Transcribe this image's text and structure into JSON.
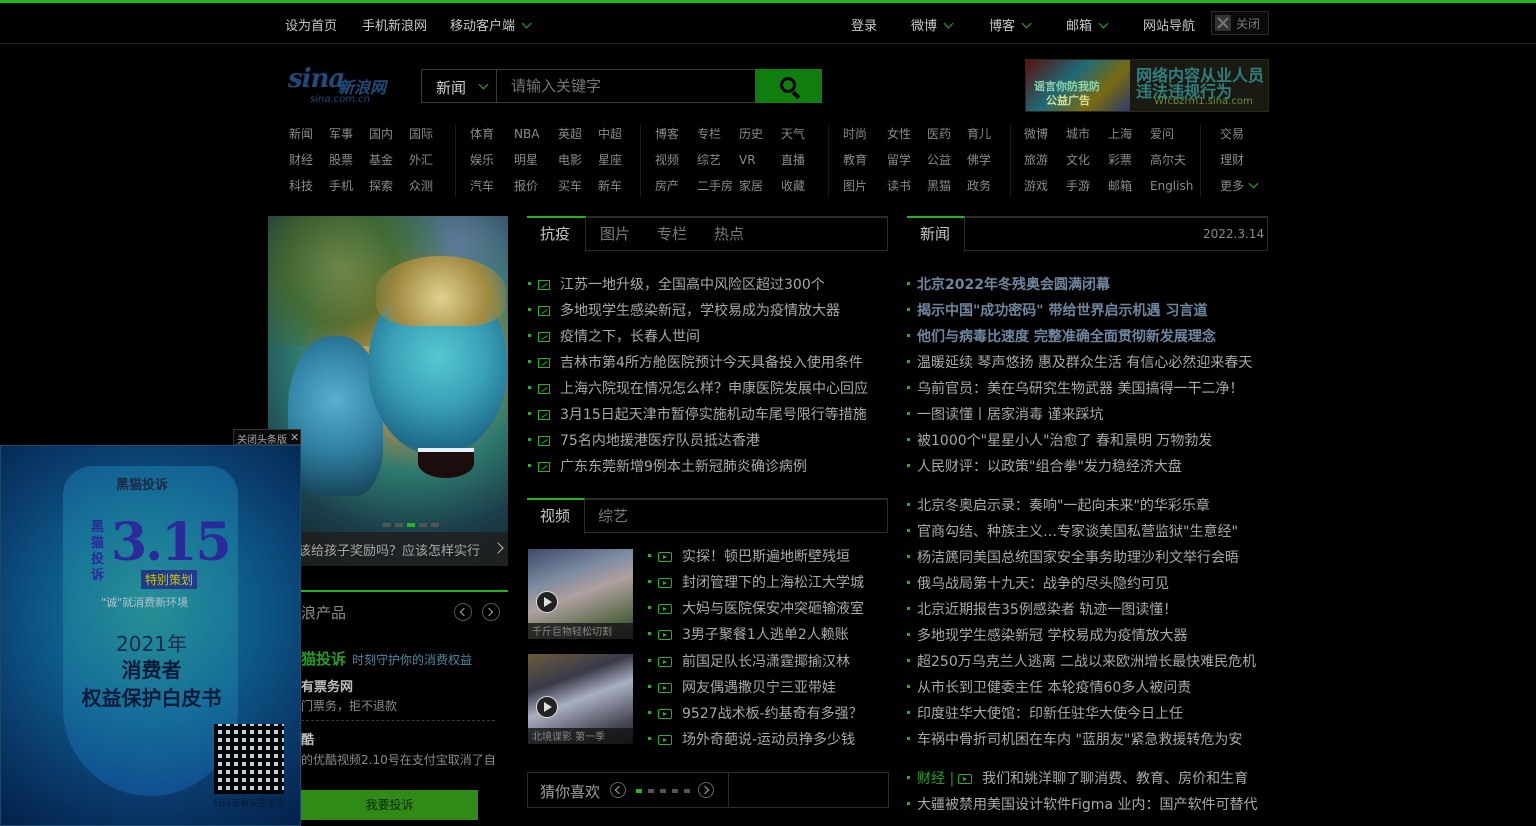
{
  "topbar": {
    "set_home": "设为首页",
    "mobile_sina": "手机新浪网",
    "mobile_client": "移动客户端",
    "login": "登录",
    "weibo": "微博",
    "blog": "博客",
    "mail": "邮箱",
    "site_nav": "网站导航",
    "close": "关闭"
  },
  "logo": {
    "text": "sina",
    "cn": "新浪网",
    "domain": "sina.com.cn"
  },
  "search": {
    "scope": "新闻",
    "placeholder": "请输入关键字"
  },
  "top_ad": {
    "pic_line1": "谣言你防我防",
    "pic_line2": "公益广告",
    "line1": "网络内容从业人员",
    "line2": "违法违规行为",
    "line3": "Wfcbzrm1.sina.com"
  },
  "nav": [
    [
      "新闻",
      "军事",
      "国内",
      "国际"
    ],
    [
      "财经",
      "股票",
      "基金",
      "外汇"
    ],
    [
      "科技",
      "手机",
      "探索",
      "众测"
    ],
    [
      "体育",
      "NBA",
      "英超",
      "中超"
    ],
    [
      "娱乐",
      "明星",
      "电影",
      "星座"
    ],
    [
      "汽车",
      "报价",
      "买车",
      "新车"
    ],
    [
      "博客",
      "专栏",
      "历史",
      "天气"
    ],
    [
      "视频",
      "综艺",
      "VR",
      "直播"
    ],
    [
      "房产",
      "二手房",
      "家居",
      "收藏"
    ],
    [
      "时尚",
      "女性",
      "医药",
      "育儿"
    ],
    [
      "教育",
      "留学",
      "公益",
      "佛学"
    ],
    [
      "图片",
      "读书",
      "黑猫",
      "政务"
    ],
    [
      "微博",
      "城市",
      "上海",
      "爱问"
    ],
    [
      "旅游",
      "文化",
      "彩票",
      "高尔夫"
    ],
    [
      "游戏",
      "手游",
      "邮箱",
      "English"
    ],
    [
      "交易",
      "理财",
      "更多"
    ]
  ],
  "banner": {
    "caption": "该给孩子奖励吗？应该怎样实行"
  },
  "center_tabs": {
    "active": "抗疫",
    "others": [
      "图片",
      "专栏",
      "热点"
    ]
  },
  "center_news": [
    "江苏一地升级，全国高中风险区超过300个",
    "多地现学生感染新冠，学校易成为疫情放大器",
    "疫情之下，长春人世间",
    "吉林市第4所方舱医院预计今天具备投入使用条件",
    "上海六院现在情况怎么样？申康医院发展中心回应",
    "3月15日起天津市暂停实施机动车尾号限行等措施",
    "75名内地援港医疗队员抵达香港",
    "广东东莞新增9例本土新冠肺炎确诊病例"
  ],
  "video_tabs": {
    "active": "视频",
    "others": [
      "综艺"
    ]
  },
  "video_thumbs": [
    "千斤巨物轻松切割",
    "北境谍影 第一季"
  ],
  "video_news": [
    "实探！顿巴斯遍地断壁残垣",
    "封闭管理下的上海松江大学城",
    "大妈与医院保安冲突砸输液室",
    "3男子聚餐1人逃单2人赖账",
    "前国足队长冯潇霆揶揄汉林",
    "网友偶遇撒贝宁三亚带娃",
    "9527战术板-约基奇有多强？",
    "场外奇葩说-运动员挣多少钱"
  ],
  "like_box": {
    "label": "猜你喜欢"
  },
  "right_tab": {
    "active": "新闻",
    "date": "2022.3.14"
  },
  "right_news_top": [
    "北京2022年冬残奥会圆满闭幕",
    "揭示中国\"成功密码\" 带给世界启示机遇 习言道",
    "他们与病毒比速度 完整准确全面贯彻新发展理念"
  ],
  "right_news": [
    "温暖延续 琴声悠扬 惠及群众生活 有信心必然迎来春天",
    "乌前官员：美在乌研究生物武器 美国搞得一干二净！",
    "一图读懂丨居家消毒 谨来踩坑",
    "被1000个\"星星小人\"治愈了 春和景明 万物勃发",
    "人民财评：以政策\"组合拳\"发力稳经济大盘",
    "北京冬奥启示录：奏响\"一起向未来\"的华彩乐章",
    "官商勾结、种族主义…专家谈美国私营监狱\"生意经\"",
    "杨洁篪同美国总统国家安全事务助理沙利文举行会晤",
    "俄乌战局第十九天：战争的尽头隐约可见",
    "北京近期报告35例感染者 轨迹一图读懂！",
    "多地现学生感染新冠 学校易成为疫情放大器",
    "超250万乌克兰人逃离 二战以来欧洲增长最快难民危机",
    "从市长到卫健委主任 本轮疫情60多人被问责",
    "印度驻华大使馆：印新任驻华大使今日上任",
    "车祸中骨折司机困在车内 \"蓝朋友\"紧急救援转危为安"
  ],
  "right_news_bottom": {
    "finance_tag": "财经 |",
    "finance_item": "我们和姚洋聊了聊消费、教育、房价和生育",
    "last_item": "大疆被禁用美国设计软件Figma 业内：国产软件可替代"
  },
  "left_panel": {
    "title": "浪产品",
    "brand": "猫投诉",
    "slogan": "时刻守护你的消费权益",
    "item1_title": "有票务网",
    "item1_desc": "门票务，拒不退款",
    "item2_title": "酷",
    "item2_desc": "的优酷视频2.10号在支付宝取消了自...",
    "button": "我要投诉"
  },
  "overlay_ad": {
    "close_label": "关闭头条版",
    "brand": "黑猫投诉",
    "big": "3.15",
    "vertical": "黑猫投诉",
    "tag": "特别策划",
    "sub": "\"诚\"就消费新环境",
    "line1": "2021年",
    "line2": "消费者",
    "line3": "权益保护白皮书",
    "qr_caption": "扫码查看完整报告"
  }
}
